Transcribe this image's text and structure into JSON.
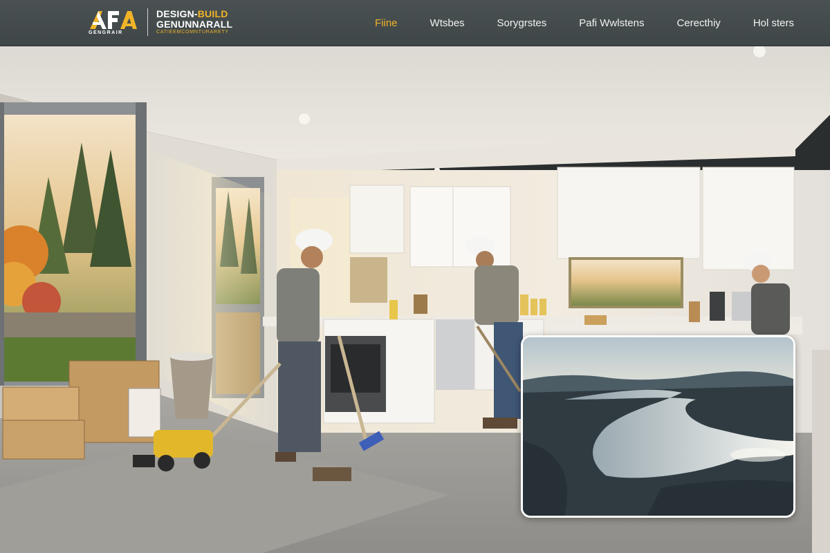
{
  "brand": {
    "logo_caption": "GENGRAIR",
    "line1_a": "DESIGN-",
    "line1_b": "BUILD",
    "line2": "GENUNNARALL",
    "line3": "CATIEEMCOMNTURARETY",
    "accent_color": "#f0b428"
  },
  "nav": {
    "items": [
      {
        "label": "Fiine",
        "active": true
      },
      {
        "label": "Wtsbes",
        "active": false
      },
      {
        "label": "Sorygrstes",
        "active": false
      },
      {
        "label": "Pafi Wwlstens",
        "active": false
      },
      {
        "label": "Cerecthiy",
        "active": false
      },
      {
        "label": "Hol sters",
        "active": false
      }
    ]
  },
  "hero": {
    "scene": "kitchen-renovation-photo",
    "inset": "aerial-lake-photo"
  }
}
